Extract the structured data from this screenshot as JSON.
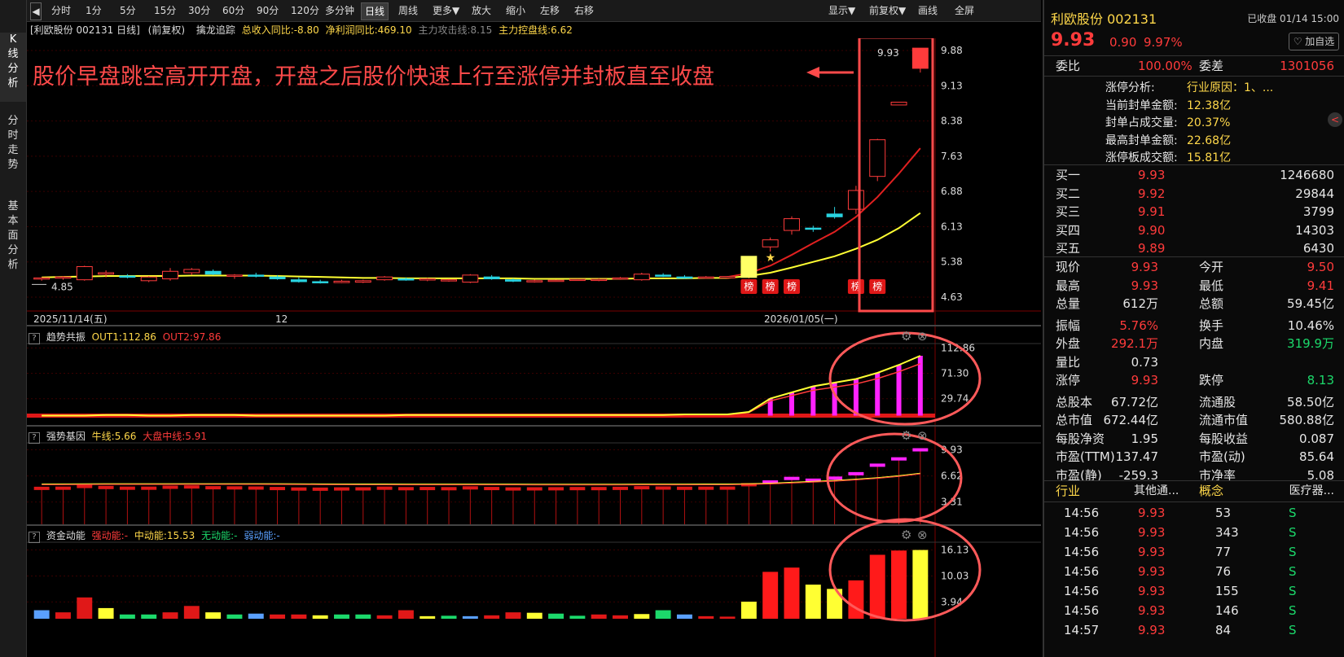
{
  "sidetabs": [
    "K线分析",
    "分时走势",
    "基本面分析"
  ],
  "toolbar": {
    "left_items": [
      "分时",
      "1分",
      "5分",
      "15分",
      "30分",
      "60分",
      "90分",
      "120分",
      "多分钟",
      "日线",
      "周线",
      "更多▼",
      "放大",
      "缩小",
      "左移",
      "右移"
    ],
    "selected": "日线",
    "right_items": [
      "显示▼",
      "前复权▼",
      "画线",
      "全屏"
    ]
  },
  "info": {
    "stock": "[利欧股份 002131 日线]",
    "adj": "(前复权)",
    "indicator": "擒龙追踪",
    "f1": "总收入同比:-8.80",
    "f2": "净利润同比:469.10",
    "f3": "主力攻击线:8.15",
    "f4": "主力控盘线:6.62"
  },
  "annotation": "股价早盘跳空高开开盘，开盘之后股价快速上行至涨停并封板直至收盘",
  "main_chart": {
    "y_ticks": [
      "9.88",
      "9.13",
      "8.38",
      "7.63",
      "6.88",
      "6.13",
      "5.38",
      "4.63"
    ],
    "low_label": "4.85",
    "high_label": "9.93",
    "dates": [
      "2025/11/14(五)",
      "12",
      "2026/01/05(一)"
    ],
    "badge": "榜"
  },
  "sub1": {
    "title": "趋势共振",
    "l1": "OUT1:112.86",
    "l2": "OUT2:97.86",
    "ticks": [
      "112.86",
      "71.30",
      "29.74"
    ]
  },
  "sub2": {
    "title": "强势基因",
    "l1": "牛线:5.66",
    "l2": "大盘中线:5.91",
    "ticks": [
      "9.93",
      "6.62",
      "3.31"
    ]
  },
  "sub3": {
    "title": "资金动能",
    "l1": "强动能:-",
    "l2": "中动能:15.53",
    "l3": "无动能:-",
    "l4": "弱动能:-",
    "ticks": [
      "16.13",
      "10.03",
      "3.94"
    ]
  },
  "chart_data": {
    "type": "candlestick",
    "title": "利欧股份 002131 日线",
    "ylim": [
      4.63,
      9.88
    ],
    "candles": [
      [
        5.02,
        5.05,
        4.98,
        5.04
      ],
      [
        5.04,
        5.08,
        5.0,
        5.06
      ],
      [
        5.0,
        5.3,
        4.98,
        5.28
      ],
      [
        5.12,
        5.2,
        5.05,
        5.15
      ],
      [
        5.08,
        5.12,
        5.03,
        5.06
      ],
      [
        4.98,
        5.08,
        4.95,
        5.06
      ],
      [
        5.02,
        5.25,
        4.98,
        5.18
      ],
      [
        5.15,
        5.25,
        5.1,
        5.22
      ],
      [
        5.18,
        5.22,
        5.1,
        5.12
      ],
      [
        5.08,
        5.12,
        5.02,
        5.1
      ],
      [
        5.1,
        5.15,
        5.05,
        5.08
      ],
      [
        5.06,
        5.1,
        5.0,
        5.02
      ],
      [
        5.0,
        5.05,
        4.94,
        4.96
      ],
      [
        4.96,
        5.0,
        4.92,
        4.94
      ],
      [
        4.94,
        5.0,
        4.93,
        4.97
      ],
      [
        4.95,
        5.0,
        4.93,
        4.98
      ],
      [
        5.0,
        5.08,
        4.98,
        5.06
      ],
      [
        5.02,
        5.05,
        4.98,
        5.0
      ],
      [
        5.0,
        5.04,
        4.97,
        5.02
      ],
      [
        4.98,
        5.02,
        4.96,
        5.0
      ],
      [
        4.95,
        5.12,
        4.93,
        5.1
      ],
      [
        5.06,
        5.1,
        5.0,
        5.02
      ],
      [
        5.0,
        5.03,
        4.95,
        4.97
      ],
      [
        4.96,
        5.0,
        4.94,
        4.98
      ],
      [
        4.98,
        5.0,
        4.96,
        4.99
      ],
      [
        5.0,
        5.02,
        4.98,
        5.01
      ],
      [
        4.99,
        5.03,
        4.97,
        5.01
      ],
      [
        5.02,
        5.06,
        5.0,
        5.04
      ],
      [
        5.0,
        5.15,
        4.98,
        5.12
      ],
      [
        5.1,
        5.14,
        5.06,
        5.08
      ],
      [
        5.06,
        5.1,
        5.02,
        5.05
      ],
      [
        5.05,
        5.08,
        5.02,
        5.06
      ],
      [
        5.04,
        5.08,
        5.02,
        5.07
      ],
      [
        5.05,
        5.5,
        5.03,
        5.5
      ],
      [
        5.7,
        5.9,
        5.6,
        5.85
      ],
      [
        6.05,
        6.35,
        5.96,
        6.3
      ],
      [
        6.1,
        6.15,
        6.02,
        6.08
      ],
      [
        6.4,
        6.55,
        6.3,
        6.34
      ],
      [
        6.5,
        7.0,
        6.4,
        6.9
      ],
      [
        7.2,
        8.0,
        7.1,
        7.98
      ],
      [
        8.72,
        8.78,
        8.72,
        8.78
      ],
      [
        9.5,
        9.93,
        9.41,
        9.93
      ]
    ],
    "ma_yellow": [
      5.05,
      5.06,
      5.07,
      5.08,
      5.08,
      5.08,
      5.08,
      5.09,
      5.09,
      5.09,
      5.09,
      5.08,
      5.07,
      5.06,
      5.05,
      5.04,
      5.04,
      5.03,
      5.03,
      5.03,
      5.03,
      5.03,
      5.03,
      5.02,
      5.02,
      5.02,
      5.02,
      5.02,
      5.03,
      5.03,
      5.03,
      5.04,
      5.04,
      5.08,
      5.15,
      5.26,
      5.38,
      5.5,
      5.66,
      5.85,
      6.1,
      6.42
    ],
    "ma_red": [
      null,
      null,
      null,
      null,
      null,
      null,
      null,
      null,
      null,
      null,
      null,
      null,
      null,
      null,
      null,
      null,
      null,
      null,
      null,
      null,
      null,
      null,
      null,
      null,
      null,
      null,
      null,
      null,
      null,
      null,
      null,
      null,
      5.06,
      5.14,
      5.3,
      5.53,
      5.78,
      6.02,
      6.34,
      6.76,
      7.26,
      7.8
    ],
    "sub1_values": [
      2,
      2,
      2,
      3,
      3,
      2,
      2,
      3,
      3,
      3,
      2,
      2,
      2,
      2,
      2,
      2,
      2,
      3,
      3,
      3,
      3,
      3,
      3,
      3,
      3,
      3,
      3,
      3,
      3,
      3,
      4,
      4,
      4,
      8,
      30,
      40,
      50,
      56,
      62,
      72,
      85,
      100,
      112.86
    ],
    "sub3_values": [
      2,
      1.5,
      5,
      2.5,
      1,
      1,
      1.5,
      3,
      1.5,
      1,
      1.2,
      1,
      1,
      0.8,
      1,
      1,
      0.8,
      2,
      0.6,
      0.7,
      0.6,
      0.8,
      1.5,
      1.4,
      1.2,
      0.7,
      1.0,
      0.8,
      1.1,
      2,
      1,
      0.6,
      0.5,
      4,
      11,
      12,
      8,
      7,
      9,
      15,
      16,
      16.13
    ]
  },
  "quote": {
    "name": "利欧股份 002131",
    "status": "已收盘 01/14 15:00",
    "price": "9.93",
    "chg": "0.90",
    "pct": "9.97%",
    "follow": "加自选",
    "weibi_label": "委比",
    "weibi": "100.00%",
    "weicha_label": "委差",
    "weicha": "1301056",
    "zt_lines": [
      {
        "k": "涨停分析:",
        "v": "行业原因：1、..."
      },
      {
        "k": "当前封单金额:",
        "v": "12.38亿"
      },
      {
        "k": "封单占成交量:",
        "v": "20.37%"
      },
      {
        "k": "最高封单金额:",
        "v": "22.68亿"
      },
      {
        "k": "涨停板成交额:",
        "v": "15.81亿"
      }
    ],
    "buys": [
      {
        "k": "买一",
        "p": "9.93",
        "v": "1246680"
      },
      {
        "k": "买二",
        "p": "9.92",
        "v": "29844"
      },
      {
        "k": "买三",
        "p": "9.91",
        "v": "3799"
      },
      {
        "k": "买四",
        "p": "9.90",
        "v": "14303"
      },
      {
        "k": "买五",
        "p": "9.89",
        "v": "6430"
      }
    ],
    "stats": [
      {
        "k1": "现价",
        "v1": "9.93",
        "c1": "red",
        "k2": "今开",
        "v2": "9.50",
        "c2": "red"
      },
      {
        "k1": "最高",
        "v1": "9.93",
        "c1": "red",
        "k2": "最低",
        "v2": "9.41",
        "c2": "red"
      },
      {
        "k1": "总量",
        "v1": "612万",
        "c1": "white",
        "k2": "总额",
        "v2": "59.45亿",
        "c2": "white"
      },
      {
        "k1": "振幅",
        "v1": "5.76%",
        "c1": "red",
        "k2": "换手",
        "v2": "10.46%",
        "c2": "white"
      },
      {
        "k1": "外盘",
        "v1": "292.1万",
        "c1": "red",
        "k2": "内盘",
        "v2": "319.9万",
        "c2": "green"
      },
      {
        "k1": "量比",
        "v1": "0.73",
        "c1": "white",
        "k2": "",
        "v2": "",
        "c2": "white"
      },
      {
        "k1": "涨停",
        "v1": "9.93",
        "c1": "red",
        "k2": "跌停",
        "v2": "8.13",
        "c2": "green"
      },
      {
        "k1": "总股本",
        "v1": "67.72亿",
        "c1": "white",
        "k2": "流通股",
        "v2": "58.50亿",
        "c2": "white"
      },
      {
        "k1": "总市值",
        "v1": "672.44亿",
        "c1": "white",
        "k2": "流通市值",
        "v2": "580.88亿",
        "c2": "white"
      },
      {
        "k1": "每股净资",
        "v1": "1.95",
        "c1": "white",
        "k2": "每股收益",
        "v2": "0.087",
        "c2": "white"
      },
      {
        "k1": "市盈(TTM)",
        "v1": "137.47",
        "c1": "white",
        "k2": "市盈(动)",
        "v2": "85.64",
        "c2": "white"
      },
      {
        "k1": "市盈(静)",
        "v1": "-259.3",
        "c1": "white",
        "k2": "市净率",
        "v2": "5.08",
        "c2": "white"
      }
    ],
    "industry_label": "行业",
    "industry": "其他通...",
    "concept_label": "概念",
    "concept": "医疗器...",
    "ticks": [
      {
        "t": "14:56",
        "p": "9.93",
        "v": "53",
        "s": "S"
      },
      {
        "t": "14:56",
        "p": "9.93",
        "v": "343",
        "s": "S"
      },
      {
        "t": "14:56",
        "p": "9.93",
        "v": "77",
        "s": "S"
      },
      {
        "t": "14:56",
        "p": "9.93",
        "v": "76",
        "s": "S"
      },
      {
        "t": "14:56",
        "p": "9.93",
        "v": "155",
        "s": "S"
      },
      {
        "t": "14:56",
        "p": "9.93",
        "v": "146",
        "s": "S"
      },
      {
        "t": "14:57",
        "p": "9.93",
        "v": "84",
        "s": "S"
      }
    ]
  }
}
